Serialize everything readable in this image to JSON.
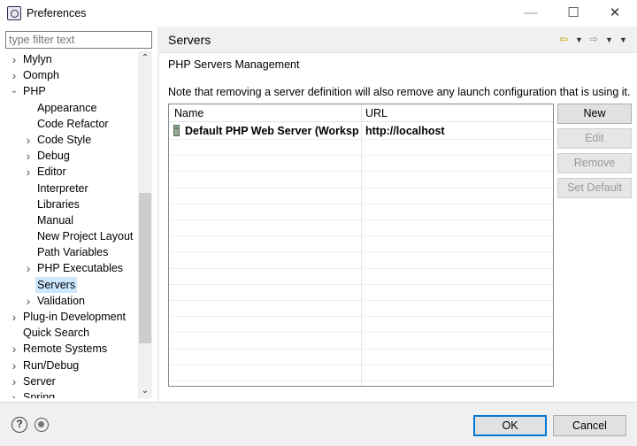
{
  "window": {
    "title": "Preferences",
    "minimize_icon": "—",
    "maximize_icon": "☐",
    "close_icon": "✕"
  },
  "sidebar": {
    "filter_placeholder": "type filter text",
    "tree": [
      {
        "label": "Mylyn",
        "level": 0,
        "expander": "collapsed"
      },
      {
        "label": "Oomph",
        "level": 0,
        "expander": "collapsed"
      },
      {
        "label": "PHP",
        "level": 0,
        "expander": "expanded"
      },
      {
        "label": "Appearance",
        "level": 1,
        "expander": "none"
      },
      {
        "label": "Code Refactor",
        "level": 1,
        "expander": "none"
      },
      {
        "label": "Code Style",
        "level": 1,
        "expander": "collapsed"
      },
      {
        "label": "Debug",
        "level": 1,
        "expander": "collapsed"
      },
      {
        "label": "Editor",
        "level": 1,
        "expander": "collapsed"
      },
      {
        "label": "Interpreter",
        "level": 1,
        "expander": "none"
      },
      {
        "label": "Libraries",
        "level": 1,
        "expander": "none"
      },
      {
        "label": "Manual",
        "level": 1,
        "expander": "none"
      },
      {
        "label": "New Project Layout",
        "level": 1,
        "expander": "none"
      },
      {
        "label": "Path Variables",
        "level": 1,
        "expander": "none"
      },
      {
        "label": "PHP Executables",
        "level": 1,
        "expander": "collapsed"
      },
      {
        "label": "Servers",
        "level": 1,
        "expander": "none",
        "selected": true
      },
      {
        "label": "Validation",
        "level": 1,
        "expander": "collapsed"
      },
      {
        "label": "Plug-in Development",
        "level": 0,
        "expander": "collapsed"
      },
      {
        "label": "Quick Search",
        "level": 0,
        "expander": "none"
      },
      {
        "label": "Remote Systems",
        "level": 0,
        "expander": "collapsed"
      },
      {
        "label": "Run/Debug",
        "level": 0,
        "expander": "collapsed"
      },
      {
        "label": "Server",
        "level": 0,
        "expander": "collapsed"
      },
      {
        "label": "Spring",
        "level": 0,
        "expander": "collapsed"
      }
    ]
  },
  "page": {
    "title": "Servers",
    "section_title": "PHP Servers Management",
    "note": "Note that removing a server definition will also remove any launch configuration that is using it.",
    "table": {
      "columns": [
        "Name",
        "URL"
      ],
      "rows": [
        {
          "name": "Default PHP Web Server (Workspace Default)",
          "url": "http://localhost"
        }
      ]
    },
    "buttons": {
      "new": "New",
      "edit": "Edit",
      "remove": "Remove",
      "set_default": "Set Default"
    }
  },
  "footer": {
    "ok": "OK",
    "cancel": "Cancel",
    "help_icon": "?"
  }
}
